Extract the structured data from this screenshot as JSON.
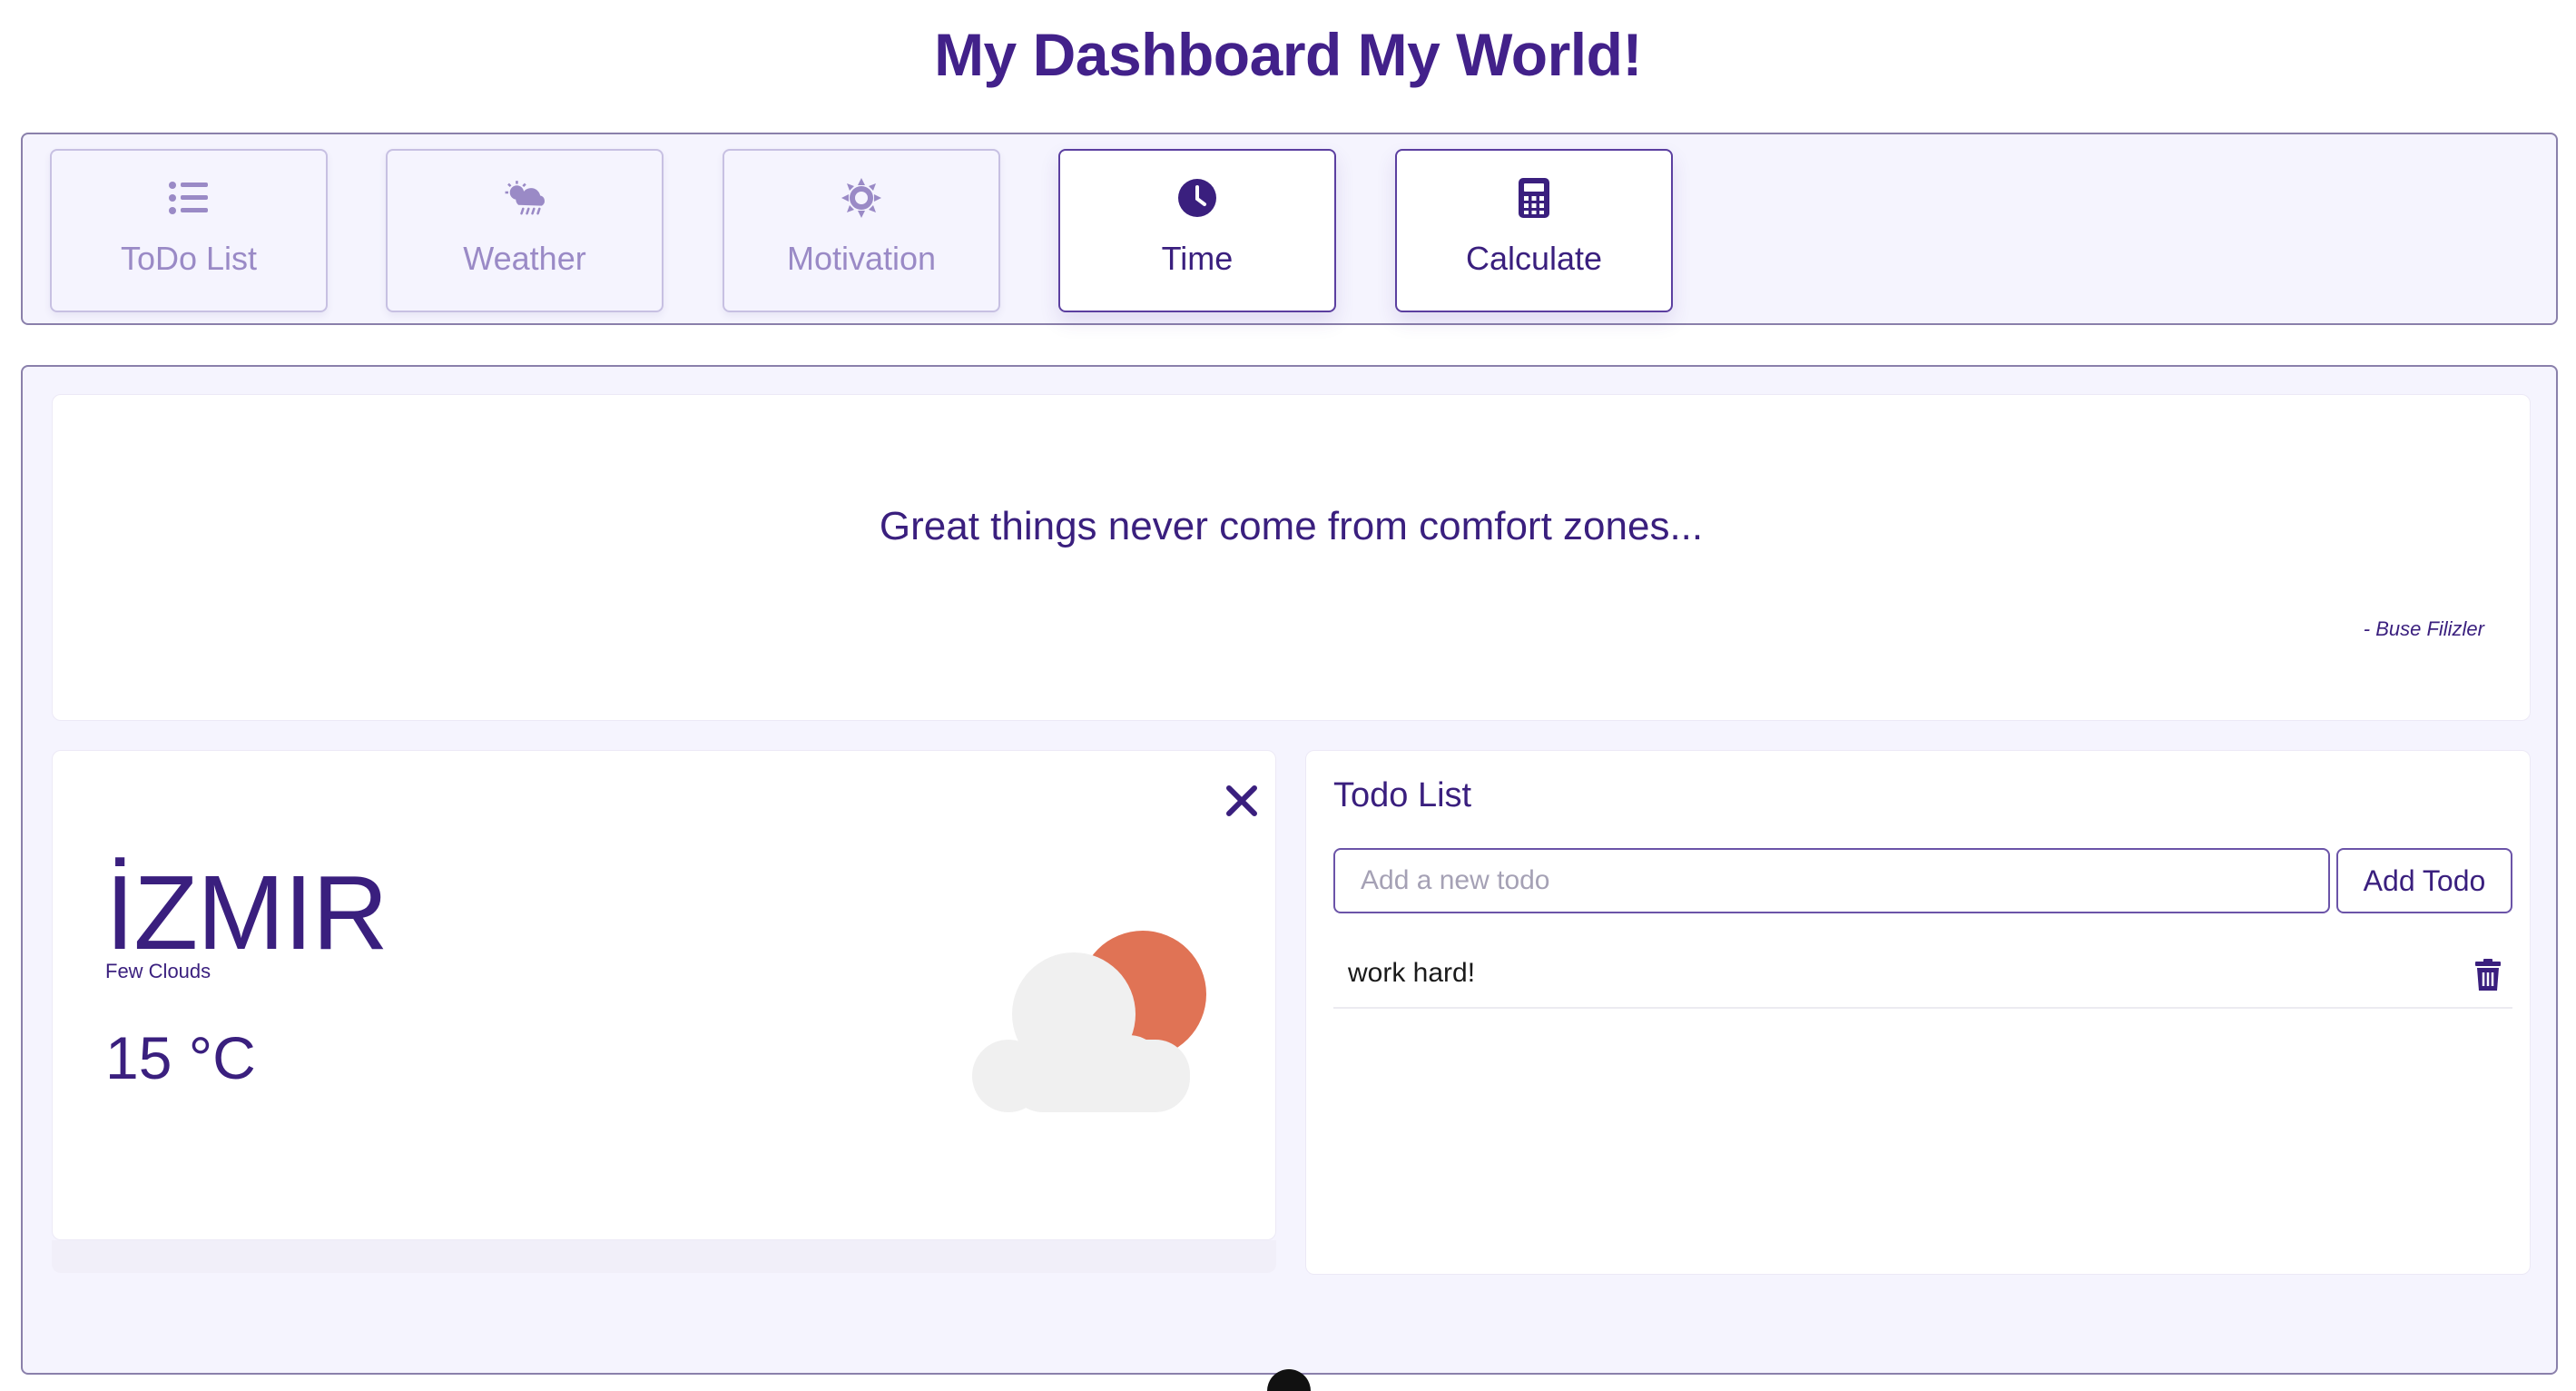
{
  "header": {
    "title": "My Dashboard My World!"
  },
  "nav": {
    "items": [
      {
        "label": "ToDo List",
        "icon": "list-icon",
        "active": false
      },
      {
        "label": "Weather",
        "icon": "cloud-sun-rain-icon",
        "active": false
      },
      {
        "label": "Motivation",
        "icon": "sun-gear-icon",
        "active": false
      },
      {
        "label": "Time",
        "icon": "clock-icon",
        "active": true
      },
      {
        "label": "Calculate",
        "icon": "calculator-icon",
        "active": true
      }
    ]
  },
  "quote": {
    "text": "Great things never come from comfort zones...",
    "author": "- Buse Filizler"
  },
  "weather": {
    "city": "İZMIR",
    "description": "Few Clouds",
    "temperature": "15 °C",
    "icon": "cloud-sun-icon"
  },
  "todo": {
    "title": "Todo List",
    "input_placeholder": "Add a new todo",
    "input_value": "",
    "add_label": "Add Todo",
    "items": [
      {
        "text": "work hard!"
      }
    ]
  },
  "colors": {
    "primary": "#3a1f7e",
    "panel_bg": "#f5f4fe",
    "sun": "#e07355",
    "cloud": "#f1f1f1"
  }
}
